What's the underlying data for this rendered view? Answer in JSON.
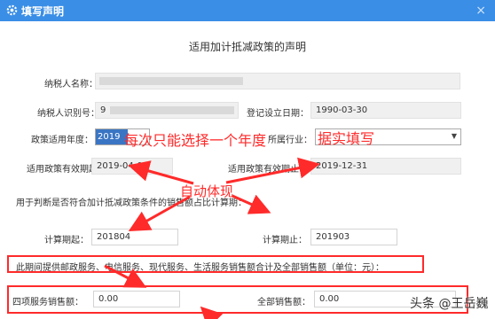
{
  "window": {
    "title": "填写声明",
    "gear_icon": "gear-icon",
    "close_glyph": "×"
  },
  "form": {
    "heading": "适用加计抵减政策的声明",
    "taxpayer_name_label": "纳税人名称：",
    "taxpayer_id_label": "纳税人识别号：",
    "taxpayer_id_value": "9",
    "registration_date_label": "登记设立日期：",
    "registration_date_value": "1990-03-30",
    "policy_year_label": "政策适用年度：",
    "policy_year_value": "2019年",
    "industry_label": "所属行业：",
    "effective_start_label": "适用政策有效期起：",
    "effective_start_value": "2019-04-01",
    "effective_end_label": "适用政策有效期止：",
    "effective_end_value": "2019-12-31",
    "ratio_note": "用于判断是否符合加计抵减政策条件的销售额占比计算期：",
    "calc_start_label": "计算期起：",
    "calc_start_value": "201804",
    "calc_end_label": "计算期止：",
    "calc_end_value": "201903",
    "services_note": "此期间提供邮政服务、电信服务、现代服务、生活服务销售额合计及全部销售额（单位：元）：",
    "four_services_label": "四项服务销售额：",
    "four_services_value": "0.00",
    "total_sales_label": "全部销售额：",
    "total_sales_value": "0.00"
  },
  "annotations": {
    "year_note": "每次只能选择一个年度",
    "fill_note": "据实填写",
    "auto_note": "自动体现"
  },
  "watermark": "头条 @王岳巍",
  "colors": {
    "titlebar": "#3a8ee6",
    "annotation_red": "#ff2a2a",
    "field_bg": "#f0f0f0"
  }
}
